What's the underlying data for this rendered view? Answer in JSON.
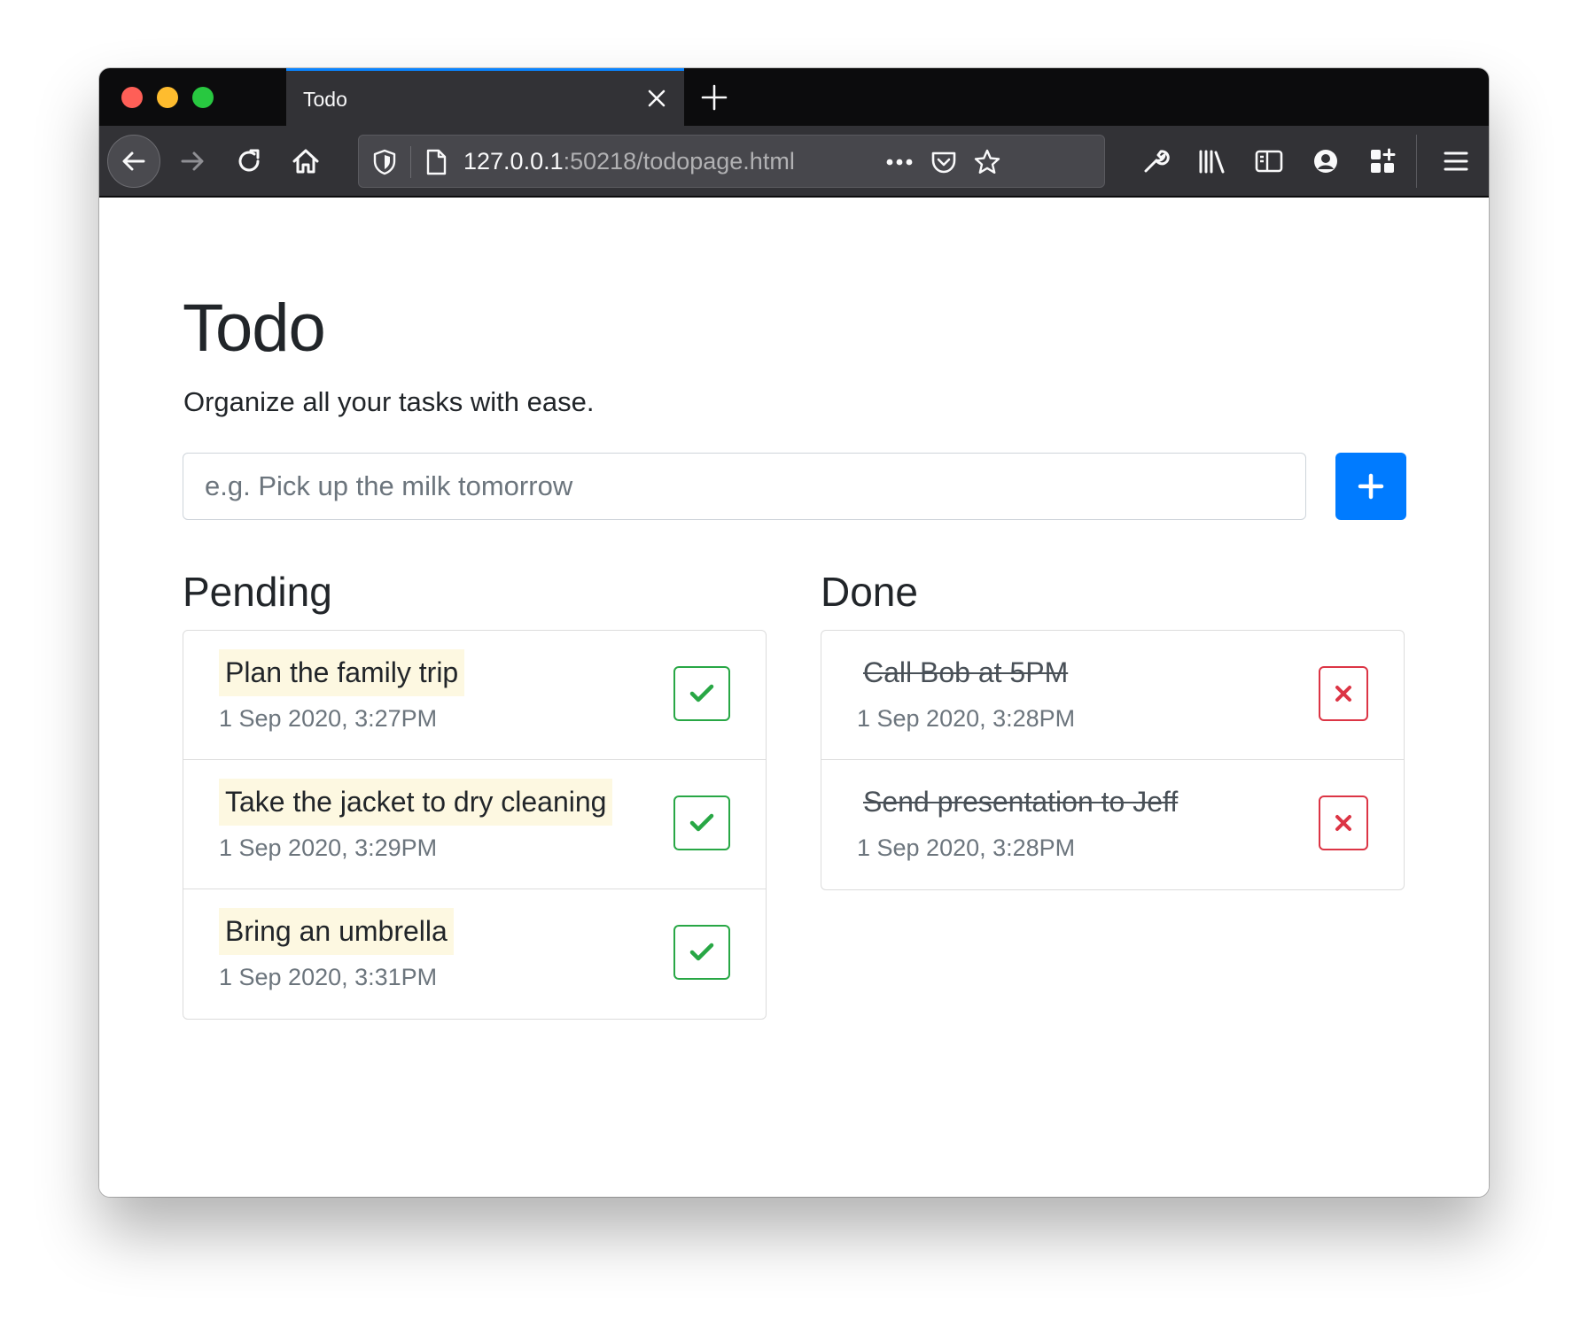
{
  "browser": {
    "tab_title": "Todo",
    "url_host": "127.0.0.1",
    "url_rest": ":50218/todopage.html",
    "icons": [
      "back-arrow-icon",
      "forward-arrow-icon",
      "reload-icon",
      "home-icon",
      "shield-icon",
      "page-icon",
      "more-dots-icon",
      "pocket-icon",
      "star-icon",
      "wrench-icon",
      "library-icon",
      "sidebar-icon",
      "account-icon",
      "extensions-icon",
      "hamburger-menu-icon"
    ],
    "accent": "#0a84ff"
  },
  "header": {
    "title": "Todo",
    "subtitle": "Organize all your tasks with ease."
  },
  "new_task": {
    "placeholder": "e.g. Pick up the milk tomorrow",
    "value": ""
  },
  "pending": {
    "heading": "Pending",
    "items": [
      {
        "text": "Plan the family trip",
        "date": "1 Sep 2020, 3:27PM"
      },
      {
        "text": "Take the jacket to dry cleaning",
        "date": "1 Sep 2020, 3:29PM"
      },
      {
        "text": "Bring an umbrella",
        "date": "1 Sep 2020, 3:31PM"
      }
    ]
  },
  "done": {
    "heading": "Done",
    "items": [
      {
        "text": "Call Bob at 5PM",
        "date": "1 Sep 2020, 3:28PM"
      },
      {
        "text": "Send presentation to Jeff",
        "date": "1 Sep 2020, 3:28PM"
      }
    ]
  },
  "colors": {
    "primary": "#007bff",
    "success": "#28a745",
    "danger": "#dc3545",
    "highlight": "#fdf8e1"
  }
}
